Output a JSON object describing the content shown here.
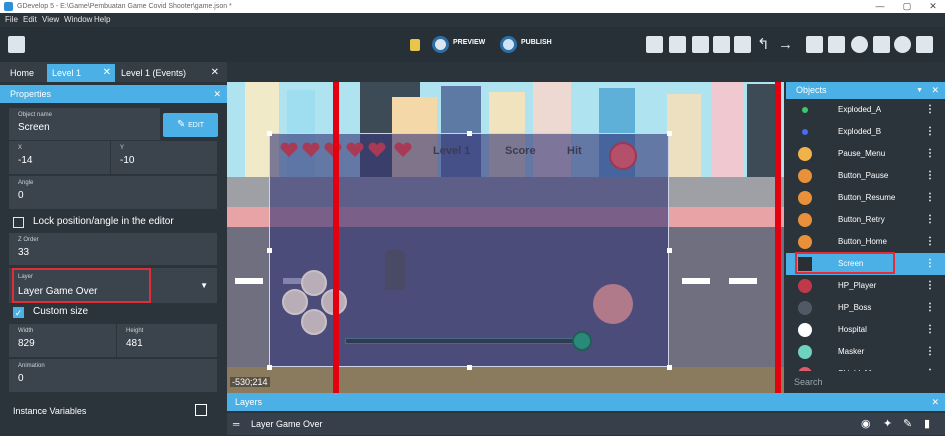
{
  "window": {
    "title": "GDevelop 5 - E:\\Game\\Pembuatan Game Covid Shooter\\game.json *",
    "minimize": "—",
    "maximize": "▢",
    "close": "✕"
  },
  "menu": [
    "File",
    "Edit",
    "View",
    "Window",
    "Help"
  ],
  "toolbar": {
    "preview": "PREVIEW",
    "publish": "PUBLISH"
  },
  "tabs": [
    {
      "label": "Home"
    },
    {
      "label": "Level 1",
      "close": "✕"
    },
    {
      "label": "Level 1 (Events)",
      "close": "✕"
    }
  ],
  "properties": {
    "title": "Properties",
    "close": "✕",
    "object_name_label": "Object name",
    "object_name": "Screen",
    "edit": "EDIT",
    "x_label": "X",
    "x": "-14",
    "y_label": "Y",
    "y": "-10",
    "angle_label": "Angle",
    "angle": "0",
    "lock_label": "Lock position/angle in the editor",
    "z_label": "Z Order",
    "z": "33",
    "layer_label": "Layer",
    "layer": "Layer Game Over",
    "custom_size_label": "Custom size",
    "width_label": "Width",
    "width": "829",
    "height_label": "Height",
    "height": "481",
    "animation_label": "Animation",
    "animation": "0",
    "instance_vars": "Instance Variables"
  },
  "scene": {
    "hud": {
      "level": "Level 1",
      "score": "Score",
      "hit": "Hit"
    },
    "coordinates": "-530;214"
  },
  "objects_panel": {
    "title": "Objects",
    "search_placeholder": "Search",
    "items": [
      {
        "name": "Exploded_A",
        "color": "#3cc86b"
      },
      {
        "name": "Exploded_B",
        "color": "#4a6cf0"
      },
      {
        "name": "Pause_Menu",
        "color": "#f1b24a"
      },
      {
        "name": "Button_Pause",
        "color": "#e8913a"
      },
      {
        "name": "Button_Resume",
        "color": "#e8913a"
      },
      {
        "name": "Button_Retry",
        "color": "#e8913a"
      },
      {
        "name": "Button_Home",
        "color": "#e8913a"
      },
      {
        "name": "Screen",
        "color": "#2a2f36"
      },
      {
        "name": "HP_Player",
        "color": "#c0394a"
      },
      {
        "name": "HP_Boss",
        "color": "#505966"
      },
      {
        "name": "Hospital",
        "color": "#ffffff"
      },
      {
        "name": "Masker",
        "color": "#6fd1c0"
      },
      {
        "name": "Shield_M",
        "color": "#e05a6a"
      }
    ]
  },
  "layers_panel": {
    "title": "Layers",
    "close": "✕",
    "layer": "Layer Game Over"
  }
}
